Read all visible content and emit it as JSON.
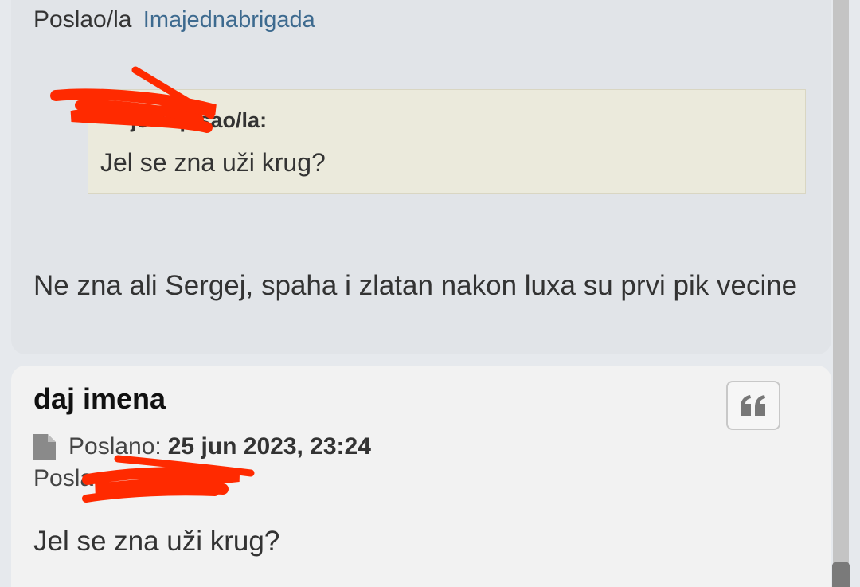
{
  "top_post": {
    "author_label": "Poslao/la",
    "author_name": "Imajednabrigada",
    "quote": {
      "cite_suffix": "je napisao/la:",
      "text": "Jel se zna uži krug?"
    },
    "body": "Ne zna ali Sergej, spaha i zlatan nakon luxa su prvi pik vecine"
  },
  "second_post": {
    "title": "daj imena",
    "posted_label": "Poslano:",
    "posted_date": "25 jun 2023, 23:24",
    "author_label": "Posla",
    "body": "Jel se zna uži krug?"
  },
  "icons": {
    "quote_button": "quote-icon",
    "file": "file-icon"
  },
  "colors": {
    "link": "#3d6a8f",
    "redaction": "#ff2a00",
    "quote_bg": "#ebeadc"
  }
}
